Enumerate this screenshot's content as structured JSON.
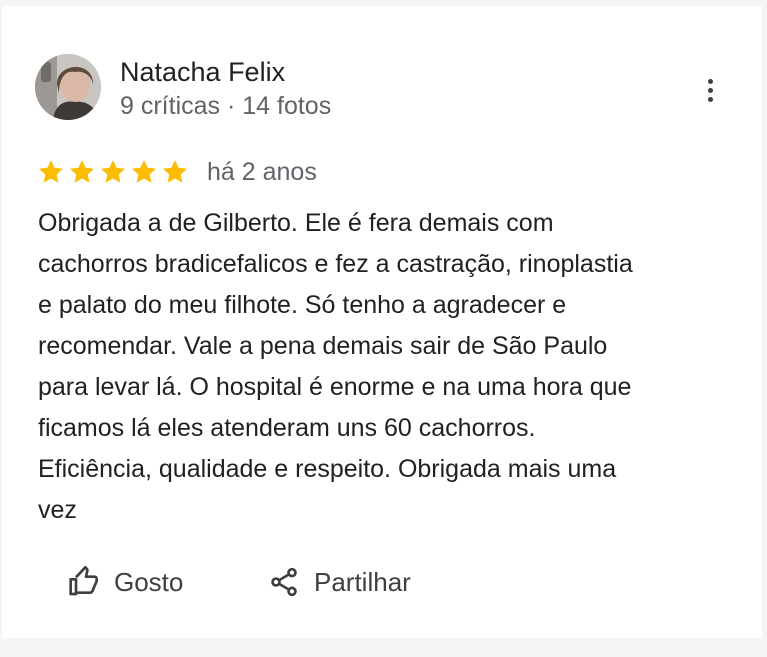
{
  "review": {
    "author": {
      "name": "Natacha Felix",
      "meta": "9 críticas · 14 fotos",
      "avatar_icon": "user-photo"
    },
    "menu_icon": "more-vert-icon",
    "rating": 5,
    "rating_max": 5,
    "star_color": "#fbbc04",
    "date": "há 2 anos",
    "text_lines": [
      "Obrigada a de Gilberto. Ele é fera demais com",
      "cachorros bradicefalicos e fez a castração, rinoplastia",
      "e palato do meu filhote. Só tenho a agradecer e",
      "recomendar. Vale a pena demais sair de São Paulo",
      "para levar lá. O hospital é enorme e na uma hora que",
      "ficamos lá eles atenderam uns 60 cachorros.",
      "Eficiência, qualidade e respeito. Obrigada mais uma",
      "vez"
    ]
  },
  "actions": {
    "like_label": "Gosto",
    "like_icon": "thumbs-up-icon",
    "share_label": "Partilhar",
    "share_icon": "share-icon"
  }
}
